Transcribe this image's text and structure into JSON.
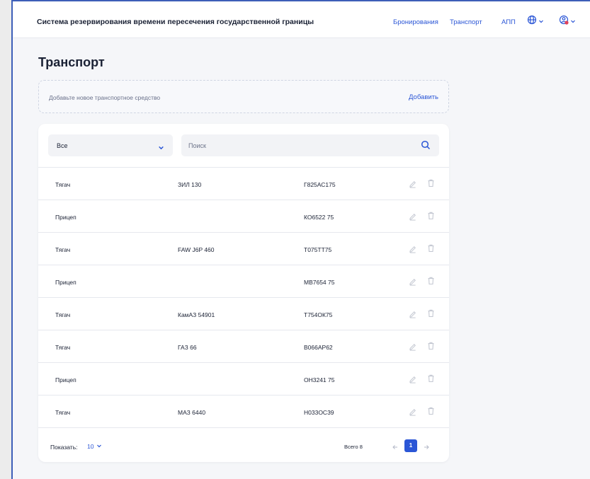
{
  "header": {
    "title": "Система резервирования времени пересечения государственной границы",
    "nav": [
      {
        "label": "Бронирования"
      },
      {
        "label": "Транспорт"
      },
      {
        "label": "АПП"
      }
    ],
    "icons": {
      "language": "globe-icon",
      "user": "user-icon"
    }
  },
  "page": {
    "title": "Транспорт"
  },
  "add_panel": {
    "hint": "Добавьте новое транспортное средство",
    "button_label": "Добавить"
  },
  "filters": {
    "type_select": {
      "value": "Все"
    },
    "search": {
      "placeholder": "Поиск",
      "value": ""
    }
  },
  "table": {
    "rows": [
      {
        "type": "Тягач",
        "model": "ЗИЛ 130",
        "plate": "Г825АС175"
      },
      {
        "type": "Прицеп",
        "model": "",
        "plate": "КО6522 75"
      },
      {
        "type": "Тягач",
        "model": "FAW J6P 460",
        "plate": "Т075ТТ75"
      },
      {
        "type": "Прицеп",
        "model": "",
        "plate": "МВ7654 75"
      },
      {
        "type": "Тягач",
        "model": "КамАЗ 54901",
        "plate": "Т754ОК75"
      },
      {
        "type": "Тягач",
        "model": "ГАЗ 66",
        "plate": "В066АР62"
      },
      {
        "type": "Прицеп",
        "model": "",
        "plate": "ОН3241 75"
      },
      {
        "type": "Тягач",
        "model": "МАЗ 6440",
        "plate": "Н033ОС39"
      }
    ]
  },
  "pagination": {
    "show_label": "Показать:",
    "page_size": "10",
    "total": "Всего 8",
    "current_page": "1"
  },
  "colors": {
    "accent": "#2b56d6",
    "background": "#f5f6f9",
    "text": "#1b2235",
    "icon_muted": "#c4c8d2"
  }
}
